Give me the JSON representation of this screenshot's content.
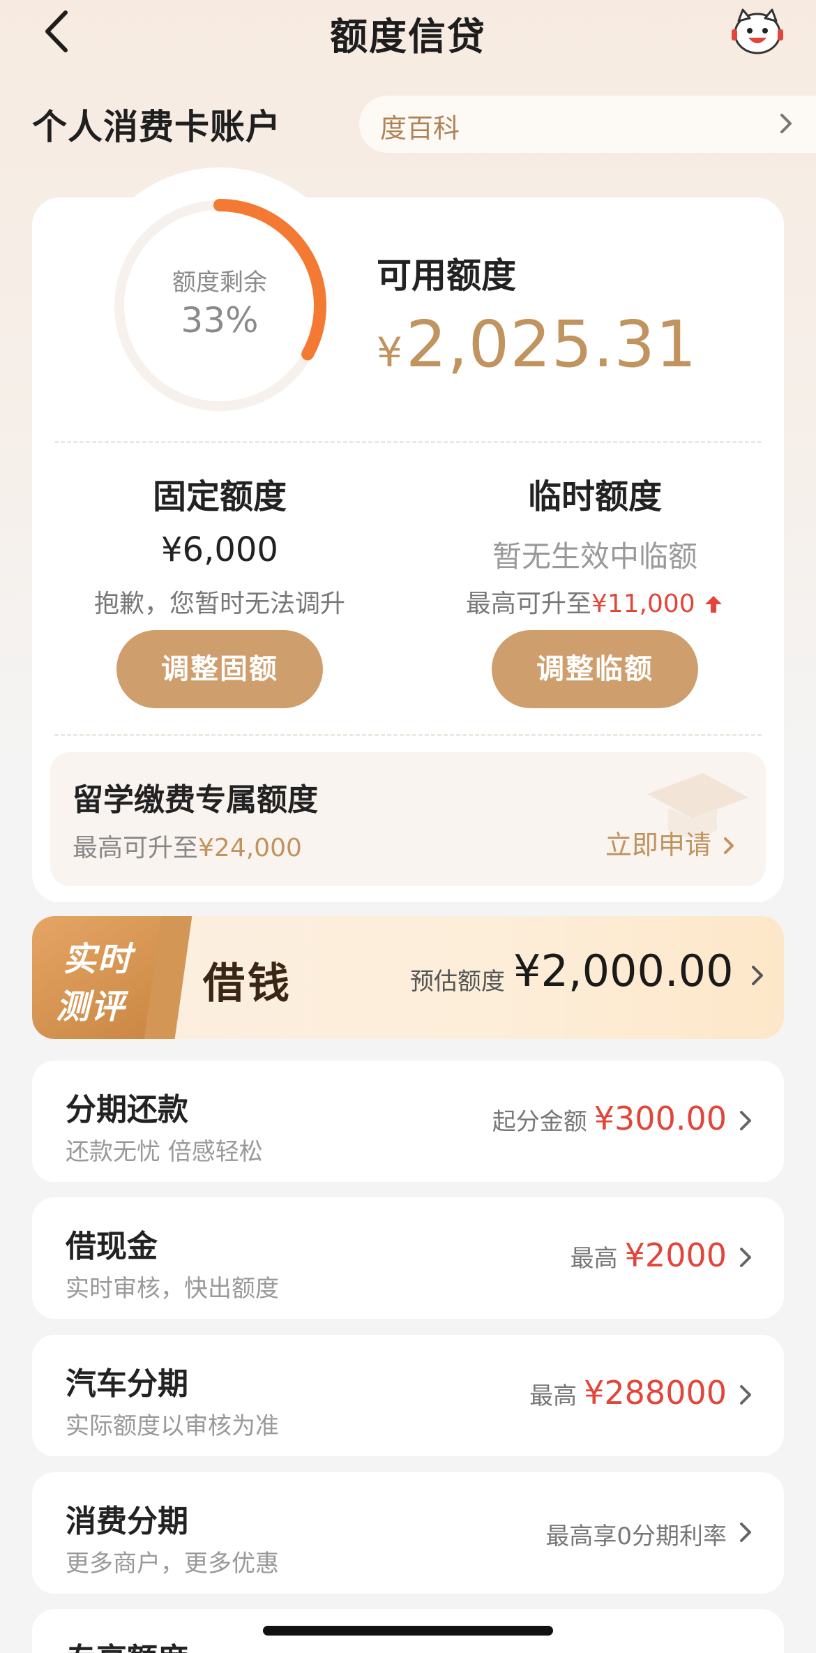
{
  "header": {
    "title": "额度信贷",
    "back_icon": "chevron-left-icon",
    "mascot_icon": "mascot-avatar-icon"
  },
  "account": {
    "title": "个人消费卡账户",
    "baike_label": "度百科"
  },
  "credit": {
    "ring_label": "额度剩余",
    "ring_percent": "33%",
    "ring_fraction": 0.33,
    "available_label": "可用额度",
    "available_currency": "¥",
    "available_amount": "2,025.31",
    "accent_color": "#f47a33",
    "gold_color": "#c0935f"
  },
  "fixed": {
    "title": "固定额度",
    "value": "¥6,000",
    "note": "抱歉，您暂时无法调升",
    "button": "调整固额"
  },
  "temporary": {
    "title": "临时额度",
    "value": "暂无生效中临额",
    "note_prefix": "最高可升至",
    "note_amount": "¥11,000",
    "button": "调整临额"
  },
  "study": {
    "title": "留学缴费专属额度",
    "sub_prefix": "最高可升至",
    "sub_amount": "¥24,000",
    "cta": "立即申请"
  },
  "borrow": {
    "tag_line1": "实时",
    "tag_line2": "测评",
    "title": "借钱",
    "est_label": "预估额度",
    "est_amount": "¥2,000.00"
  },
  "list": [
    {
      "title": "分期还款",
      "sub": "还款无忧 倍感轻松",
      "right_label": "起分金额",
      "right_amount": "¥300.00"
    },
    {
      "title": "借现金",
      "sub": "实时审核，快出额度",
      "right_label": "最高",
      "right_amount": "¥2000"
    },
    {
      "title": "汽车分期",
      "sub": "实际额度以审核为准",
      "right_label": "最高",
      "right_amount": "¥288000"
    },
    {
      "title": "消费分期",
      "sub": "更多商户，更多优惠",
      "right_label": "最高享0分期利率",
      "right_amount": ""
    },
    {
      "title": "专享额度",
      "sub": "",
      "right_label": "",
      "right_amount": ""
    }
  ]
}
